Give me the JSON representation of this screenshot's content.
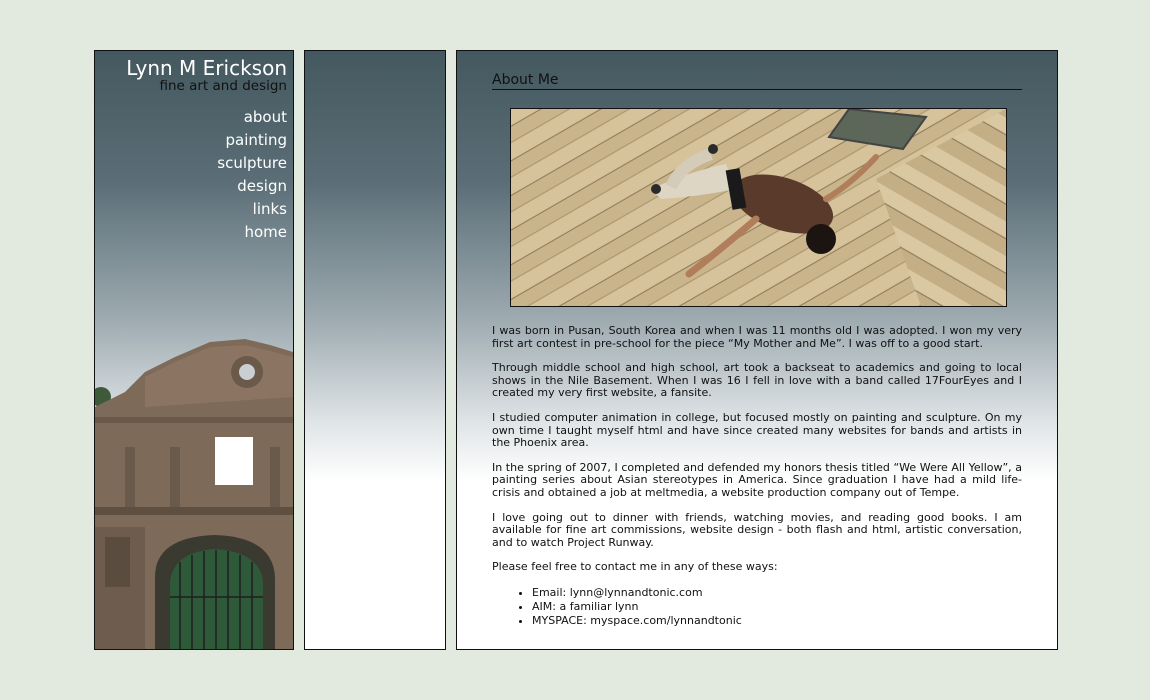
{
  "site": {
    "name": "Lynn M Erickson",
    "tagline": "fine art and design"
  },
  "nav": [
    "about",
    "painting",
    "sculpture",
    "design",
    "links",
    "home"
  ],
  "page": {
    "heading": "About Me",
    "paragraphs": [
      "I was born in Pusan, South Korea and when I was 11 months old I was adopted. I won my very first art contest in pre-school for the piece “My Mother and Me”. I was off to a good start.",
      "Through middle school and high school, art took a backseat to academics and going to local shows in the Nile Basement. When I was 16 I fell in love with a band called 17FourEyes and I created my very first website, a fansite.",
      "I studied computer animation in college, but focused mostly on painting and sculpture. On my own time I taught myself html and have since created many websites for bands and artists in the Phoenix area.",
      "In the spring of 2007, I completed and defended my honors thesis titled “We Were All Yellow”, a painting series about Asian stereotypes in America. Since graduation I have had a mild life-crisis and obtained a job at meltmedia, a website production company out of Tempe.",
      "I love going out to dinner with friends, watching movies, and reading good books. I am available for fine art commissions, website design - both flash and html, artistic conversation, and to watch Project Runway.",
      "Please feel free to contact me in any of these ways:"
    ],
    "contacts": [
      "Email: lynn@lynnandtonic.com",
      "AIM: a familiar lynn",
      "MYSPACE: myspace.com/lynnandtonic"
    ]
  },
  "colors": {
    "page_bg": "#e2eae0",
    "panel_top": "#44585f",
    "panel_bottom": "#ffffff"
  }
}
